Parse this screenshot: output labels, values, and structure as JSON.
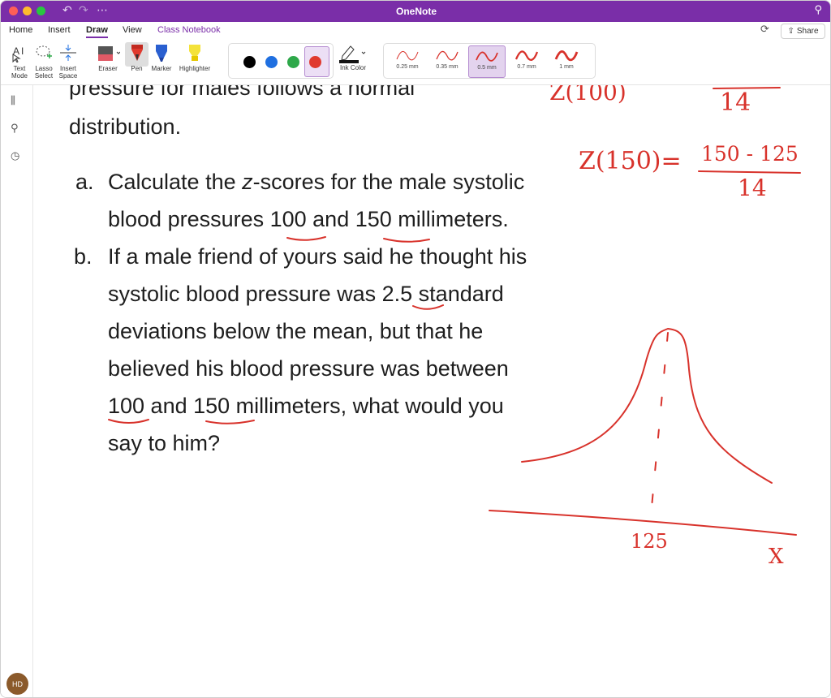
{
  "window": {
    "title": "OneNote"
  },
  "tabs": [
    {
      "label": "Home"
    },
    {
      "label": "Insert"
    },
    {
      "label": "Draw"
    },
    {
      "label": "View"
    },
    {
      "label": "Class Notebook"
    }
  ],
  "share_label": "Share",
  "tools": {
    "text_mode": "Text Mode",
    "lasso_select": "Lasso Select",
    "insert_space": "Insert Space",
    "eraser": "Eraser",
    "pen": "Pen",
    "marker": "Marker",
    "highlighter": "Highlighter",
    "ink_color": "Ink Color"
  },
  "ink_colors": [
    "#000000",
    "#1f6fe0",
    "#2ea84a",
    "#e03a2e"
  ],
  "selected_ink_color": "#e03a2e",
  "pen_widths": [
    {
      "label": "0.25 mm"
    },
    {
      "label": "0.35 mm"
    },
    {
      "label": "0.5 mm"
    },
    {
      "label": "0.7 mm"
    },
    {
      "label": "1 mm"
    }
  ],
  "avatar_initials": "HD",
  "content": {
    "partial_line": "pressure for males follows a normal",
    "line_distribution": "distribution.",
    "item_a_label": "a.",
    "item_a_line1_pre": "Calculate the ",
    "item_a_line1_z": "z",
    "item_a_line1_post": "-scores for the male systolic",
    "item_a_line2": "blood pressures 100 and 150 millimeters.",
    "item_b_label": "b.",
    "item_b_lines": [
      "If a male friend of yours said he thought his",
      "systolic blood pressure was 2.5 standard",
      "deviations below the mean, but that he",
      "believed his blood pressure was between",
      "100 and 150 millimeters, what would you",
      "say to him?"
    ]
  },
  "handwriting": {
    "top_partial": "Z(100)",
    "top_denominator": "14",
    "z_label": "Z(150)=",
    "numerator": "150 - 125",
    "denominator": "14",
    "mean_label": "125",
    "axis_label": "X"
  }
}
